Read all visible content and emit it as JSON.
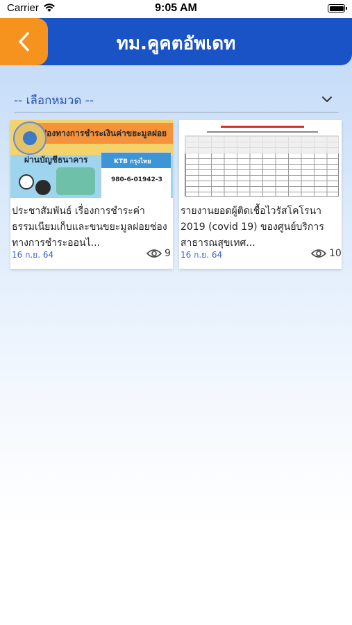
{
  "status_bar": {
    "carrier": "Carrier",
    "time": "9:05 AM"
  },
  "header": {
    "title": "ทม.คูคตอัพเดท",
    "back_icon": "chevron-left-icon"
  },
  "filter": {
    "category_label": "-- เลือกหมวด --",
    "chevron_icon": "chevron-down-icon"
  },
  "news": [
    {
      "title": "ประชาสัมพันธ์ เรื่องการชำระค่าธรรมเนียมเก็บและขนขยะมูลฝอยช่องทางการชำระออนไ...",
      "date": "16 ก.ย. 64",
      "views": "9",
      "thumb_heading": "ช่องทางการชำระเงินค่าขยะมูลฝอย",
      "thumb_sub": "ผ่านบัญชีธนาคาร",
      "thumb_bank": "KTB กรุงไทย",
      "thumb_account": "980-6-01942-3"
    },
    {
      "title": "รายงานยอดผู้ติดเชื้อไวรัสโคโรนา 2019 (covid 19) ของศูนย์บริการสาธารณสุขเทศ...",
      "date": "16 ก.ย. 64",
      "views": "10"
    }
  ],
  "colors": {
    "header": "#1a53c5",
    "back_button": "#f6921e",
    "accent_text": "#2952b8",
    "date_text": "#3a63c7"
  }
}
